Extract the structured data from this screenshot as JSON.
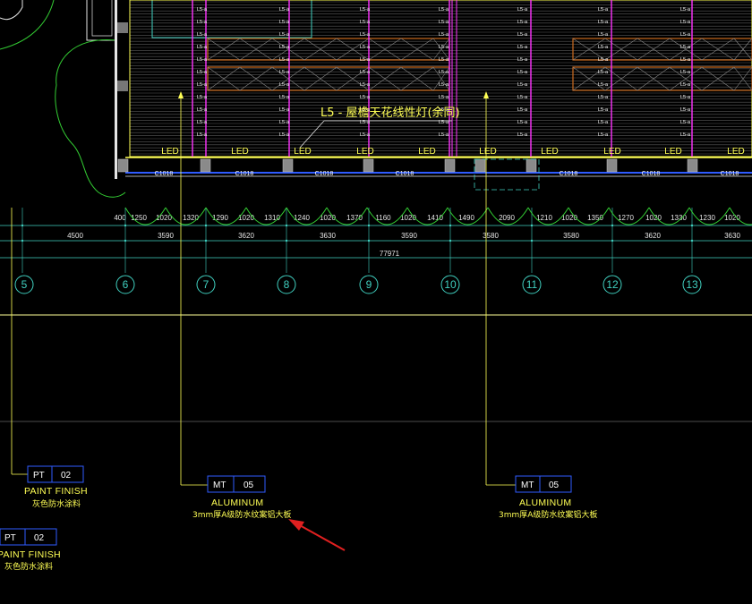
{
  "drawing": {
    "callout_label": "L5 - 屋檐天花线性灯(余同)",
    "led_label": "LED",
    "beam_label": "C1018",
    "small_fixture_label": "L5-a",
    "top_dims": [
      "400",
      "1250",
      "1020",
      "1320",
      "1290",
      "1020",
      "1310",
      "1240",
      "1020",
      "1370",
      "1160",
      "1020",
      "1410",
      "1490",
      "2090",
      "1210",
      "1020",
      "1350",
      "1270",
      "1020",
      "1330",
      "1230",
      "1020"
    ],
    "mid_dims": [
      "4500",
      "3590",
      "3620",
      "3630",
      "3590",
      "3580",
      "3580",
      "3620",
      "3630"
    ],
    "total_dim": "77971",
    "axes": [
      "5",
      "6",
      "7",
      "8",
      "9",
      "10",
      "11",
      "12",
      "13"
    ],
    "tags": [
      {
        "code": "PT",
        "num": "02",
        "title": "PAINT FINISH",
        "sub": "灰色防水涂料",
        "id": "pt-02-a"
      },
      {
        "code": "MT",
        "num": "05",
        "title": "ALUMINUM",
        "sub": "3mm厚A级防水纹案铝大板",
        "id": "mt-05-a"
      },
      {
        "code": "MT",
        "num": "05",
        "title": "ALUMINUM",
        "sub": "3mm厚A级防水纹案铝大板",
        "id": "mt-05-b"
      },
      {
        "code": "PT",
        "num": "02",
        "title": "PAINT FINISH",
        "sub": "灰色防水涂料",
        "id": "pt-02-b"
      }
    ],
    "colors": {
      "background": "#000000",
      "cyan": "#40d0c0",
      "yellow": "#ffff55",
      "magenta": "#ff33ff",
      "green": "#33cc33",
      "orange": "#cc6a1e",
      "blue": "#2f5bff",
      "arrow": "#e02020"
    }
  }
}
